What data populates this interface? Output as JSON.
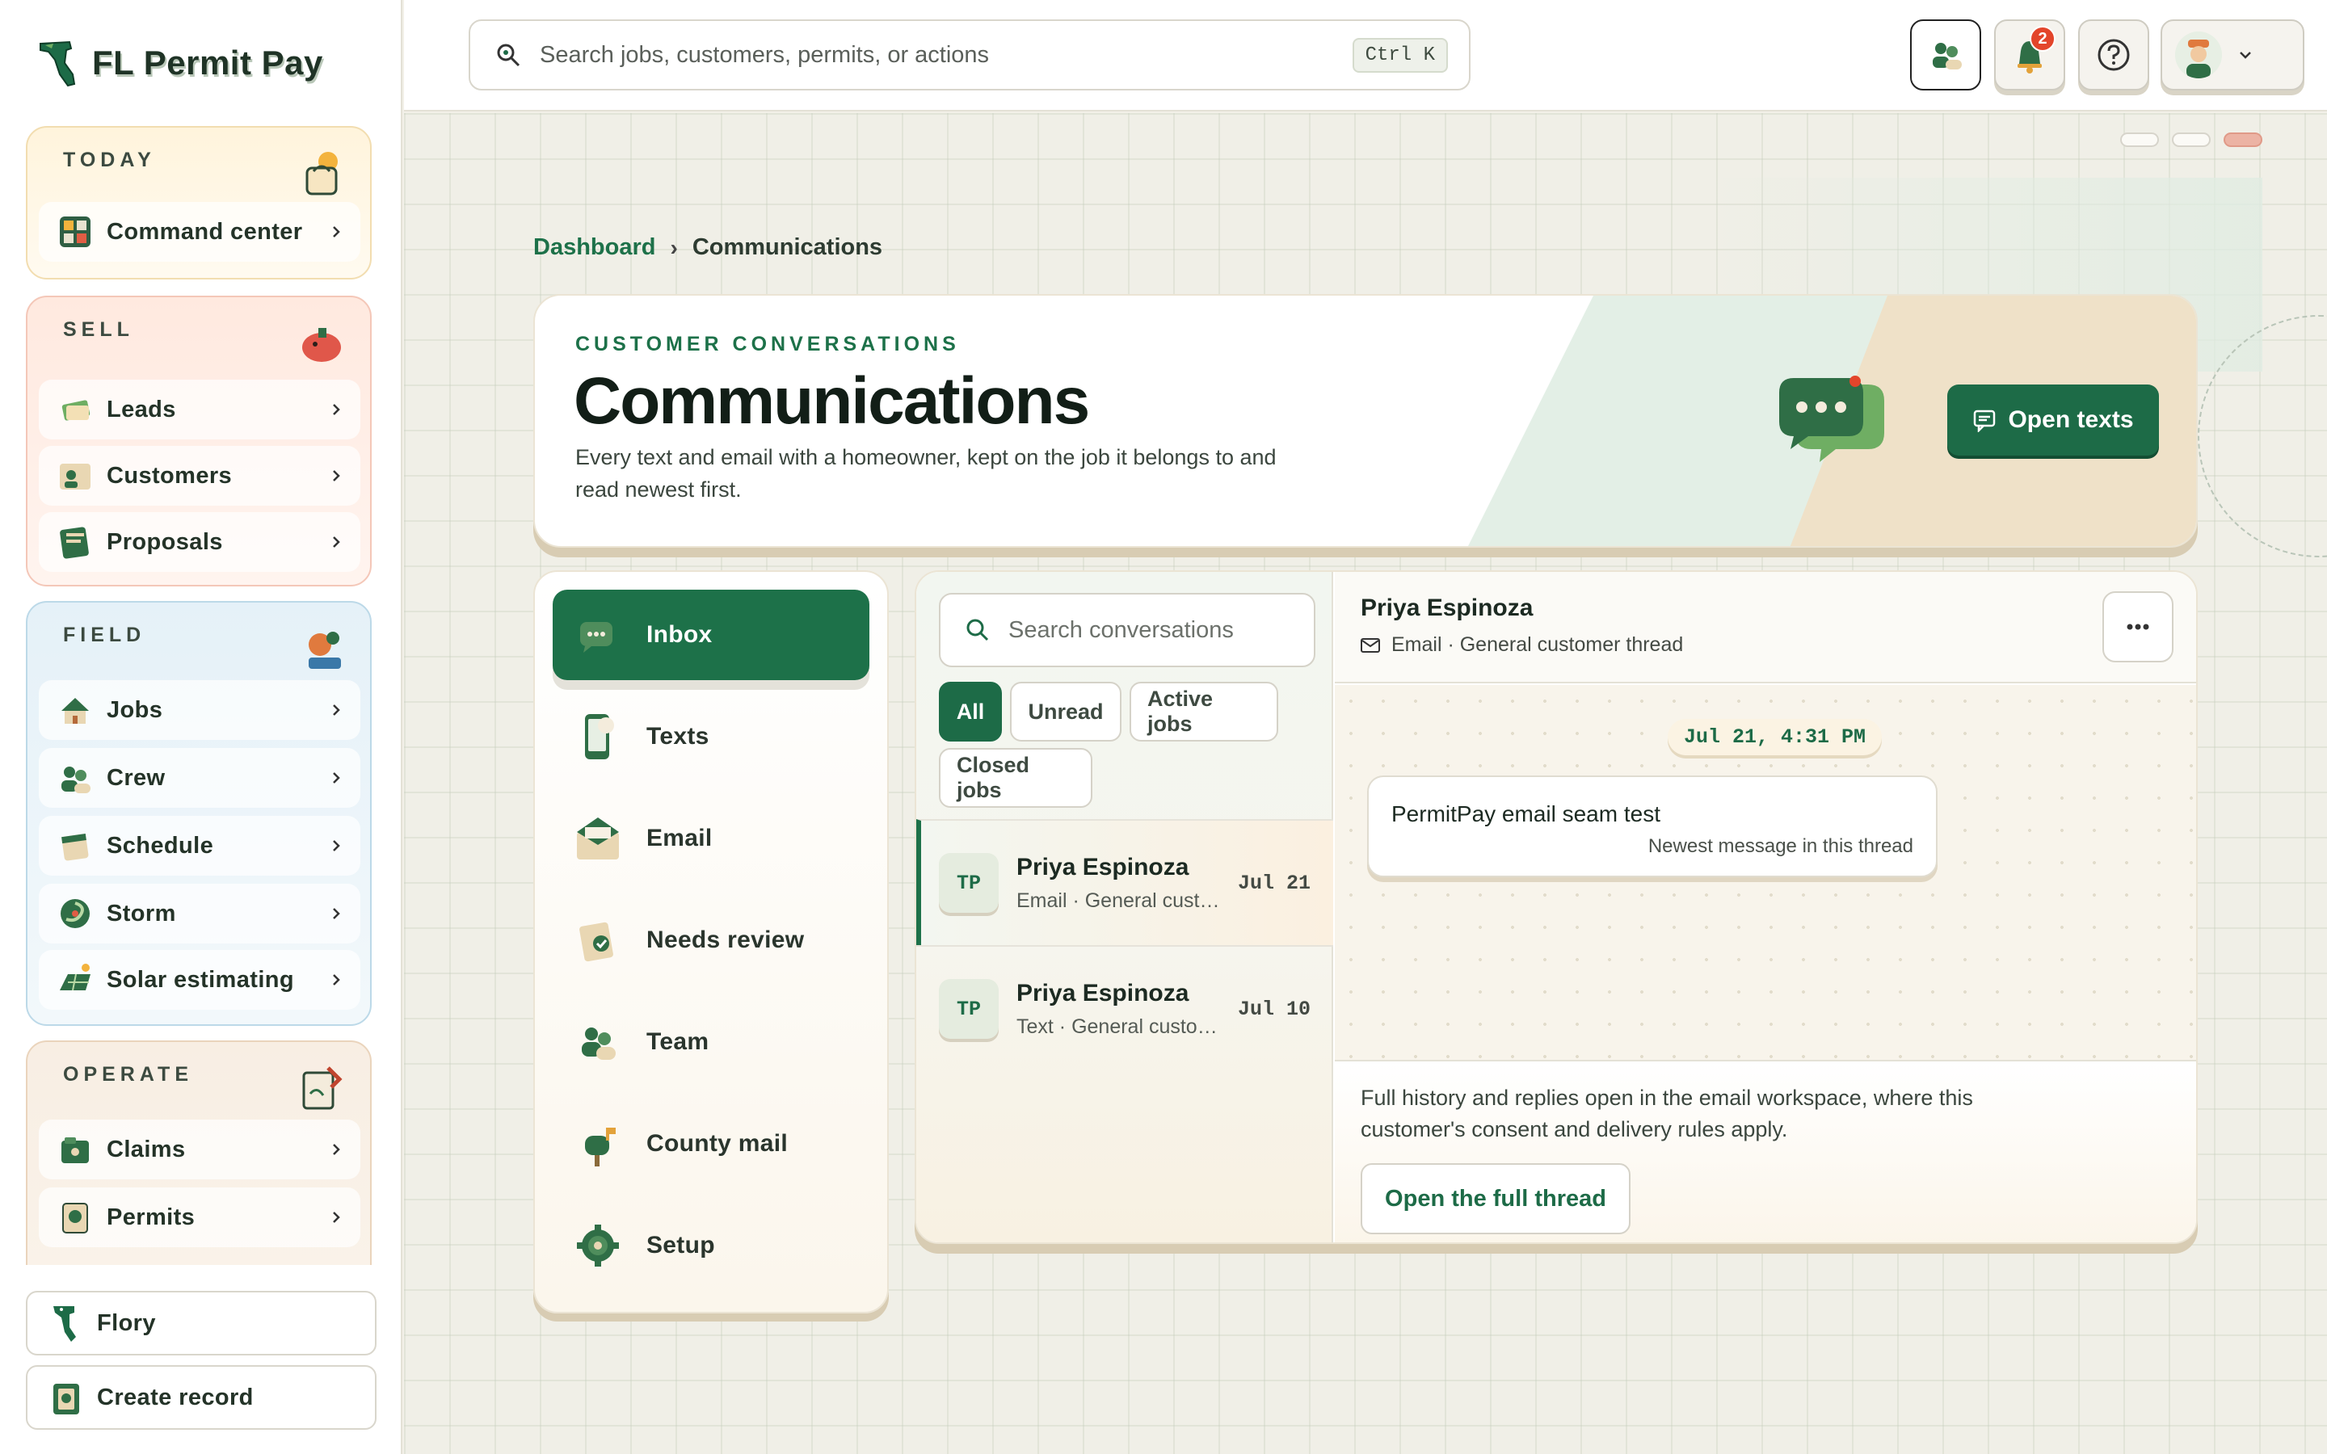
{
  "app": {
    "name": "FL Permit Pay"
  },
  "sidebar": {
    "groups": [
      {
        "label": "TODAY",
        "items": [
          {
            "label": "Command center"
          }
        ]
      },
      {
        "label": "SELL",
        "items": [
          {
            "label": "Leads"
          },
          {
            "label": "Customers"
          },
          {
            "label": "Proposals"
          }
        ]
      },
      {
        "label": "FIELD",
        "items": [
          {
            "label": "Jobs"
          },
          {
            "label": "Crew"
          },
          {
            "label": "Schedule"
          },
          {
            "label": "Storm"
          },
          {
            "label": "Solar estimating"
          }
        ]
      },
      {
        "label": "OPERATE",
        "items": [
          {
            "label": "Claims"
          },
          {
            "label": "Permits"
          }
        ]
      }
    ],
    "bottom": {
      "flory": "Flory",
      "create": "Create record"
    }
  },
  "topbar": {
    "search_placeholder": "Search jobs, customers, permits, or actions",
    "shortcut": "Ctrl K",
    "notifications_count": "2"
  },
  "breadcrumb": {
    "root": "Dashboard",
    "separator": "›",
    "current": "Communications"
  },
  "hero": {
    "eyebrow": "CUSTOMER CONVERSATIONS",
    "title": "Communications",
    "description": "Every text and email with a homeowner, kept on the job it belongs to and read newest first.",
    "cta": "Open texts"
  },
  "channels": [
    {
      "label": "Inbox",
      "icon": "inbox-icon",
      "active": true
    },
    {
      "label": "Texts",
      "icon": "phone-icon"
    },
    {
      "label": "Email",
      "icon": "envelope-icon"
    },
    {
      "label": "Needs review",
      "icon": "clipboard-check-icon"
    },
    {
      "label": "Team",
      "icon": "team-icon"
    },
    {
      "label": "County mail",
      "icon": "mailbox-icon"
    },
    {
      "label": "Setup",
      "icon": "gear-icon"
    }
  ],
  "conversations": {
    "search_placeholder": "Search conversations",
    "filters": [
      "All",
      "Unread",
      "Active jobs",
      "Closed jobs"
    ],
    "threads": [
      {
        "initials": "TP",
        "name": "Priya Espinoza",
        "subtitle": "Email · General customer thread",
        "date": "Jul 21"
      },
      {
        "initials": "TP",
        "name": "Priya Espinoza",
        "subtitle": "Text · General customer thread",
        "date": "Jul 10"
      }
    ]
  },
  "detail": {
    "name": "Priya Espinoza",
    "subtitle": "Email · General customer thread",
    "timestamp": "Jul 21, 4:31 PM",
    "message": "PermitPay email seam test",
    "message_note": "Newest message in this thread",
    "footer_text": "Full history and replies open in the email workspace, where this customer's consent and delivery rules apply.",
    "footer_cta": "Open the full thread"
  },
  "colors": {
    "brand_green": "#1d6b47",
    "alert_red": "#e3452b",
    "cream": "#efe1c8"
  }
}
